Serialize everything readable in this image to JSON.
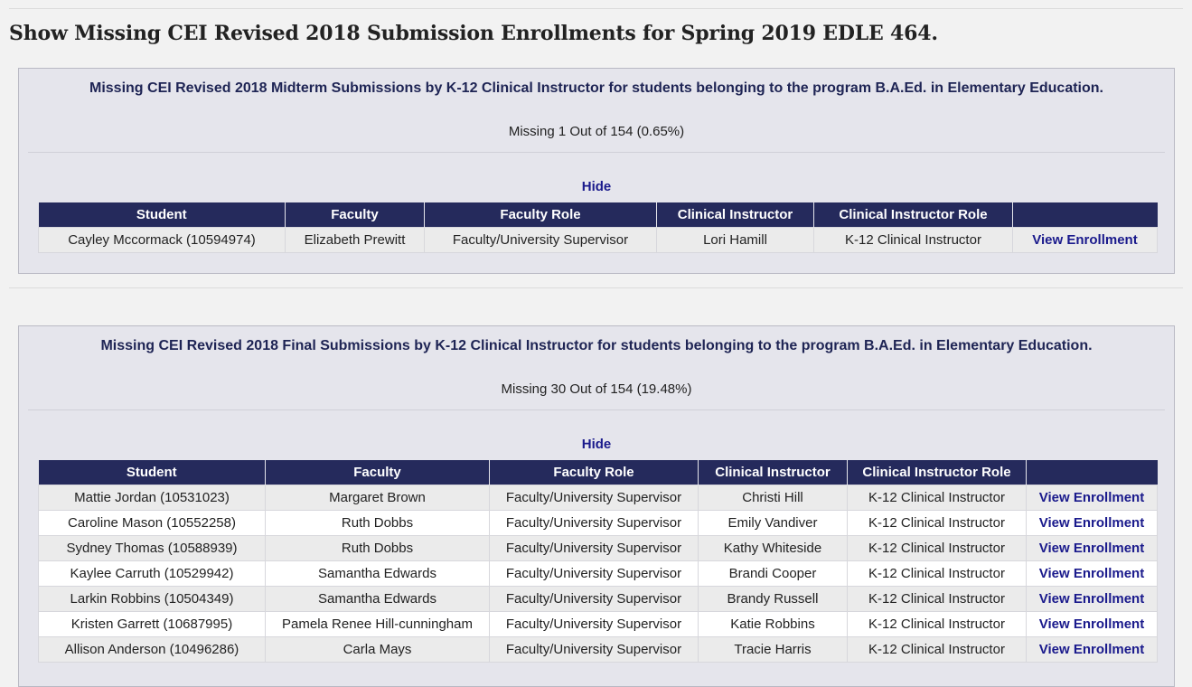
{
  "page": {
    "title": "Show Missing CEI Revised 2018 Submission Enrollments for Spring 2019 EDLE 464."
  },
  "columns": [
    "Student",
    "Faculty",
    "Faculty Role",
    "Clinical Instructor",
    "Clinical Instructor Role",
    ""
  ],
  "midterm": {
    "heading": "Missing CEI Revised 2018 Midterm Submissions by K-12 Clinical Instructor for students belonging to the program B.A.Ed. in Elementary Education.",
    "stat": "Missing 1 Out of 154 (0.65%)",
    "hide_label": "Hide",
    "rows": [
      {
        "student": "Cayley Mccormack (10594974)",
        "faculty": "Elizabeth Prewitt",
        "faculty_role": "Faculty/University Supervisor",
        "instructor": "Lori Hamill",
        "instructor_role": "K-12 Clinical Instructor",
        "action": "View Enrollment"
      }
    ]
  },
  "final": {
    "heading": "Missing CEI Revised 2018 Final Submissions by K-12 Clinical Instructor for students belonging to the program B.A.Ed. in Elementary Education.",
    "stat": "Missing 30 Out of 154 (19.48%)",
    "hide_label": "Hide",
    "rows": [
      {
        "student": "Mattie Jordan (10531023)",
        "faculty": "Margaret Brown",
        "faculty_role": "Faculty/University Supervisor",
        "instructor": "Christi Hill",
        "instructor_role": "K-12 Clinical Instructor",
        "action": "View Enrollment"
      },
      {
        "student": "Caroline Mason (10552258)",
        "faculty": "Ruth Dobbs",
        "faculty_role": "Faculty/University Supervisor",
        "instructor": "Emily Vandiver",
        "instructor_role": "K-12 Clinical Instructor",
        "action": "View Enrollment"
      },
      {
        "student": "Sydney Thomas (10588939)",
        "faculty": "Ruth Dobbs",
        "faculty_role": "Faculty/University Supervisor",
        "instructor": "Kathy Whiteside",
        "instructor_role": "K-12 Clinical Instructor",
        "action": "View Enrollment"
      },
      {
        "student": "Kaylee Carruth (10529942)",
        "faculty": "Samantha Edwards",
        "faculty_role": "Faculty/University Supervisor",
        "instructor": "Brandi Cooper",
        "instructor_role": "K-12 Clinical Instructor",
        "action": "View Enrollment"
      },
      {
        "student": "Larkin Robbins (10504349)",
        "faculty": "Samantha Edwards",
        "faculty_role": "Faculty/University Supervisor",
        "instructor": "Brandy Russell",
        "instructor_role": "K-12 Clinical Instructor",
        "action": "View Enrollment"
      },
      {
        "student": "Kristen Garrett (10687995)",
        "faculty": "Pamela Renee Hill-cunningham",
        "faculty_role": "Faculty/University Supervisor",
        "instructor": "Katie Robbins",
        "instructor_role": "K-12 Clinical Instructor",
        "action": "View Enrollment"
      },
      {
        "student": "Allison Anderson (10496286)",
        "faculty": "Carla Mays",
        "faculty_role": "Faculty/University Supervisor",
        "instructor": "Tracie Harris",
        "instructor_role": "K-12 Clinical Instructor",
        "action": "View Enrollment"
      }
    ]
  },
  "colors": {
    "header_bg": "#252a5c",
    "heading_text": "#1e2454",
    "link": "#1a1a8c",
    "panel_bg": "#e5e5ec"
  }
}
